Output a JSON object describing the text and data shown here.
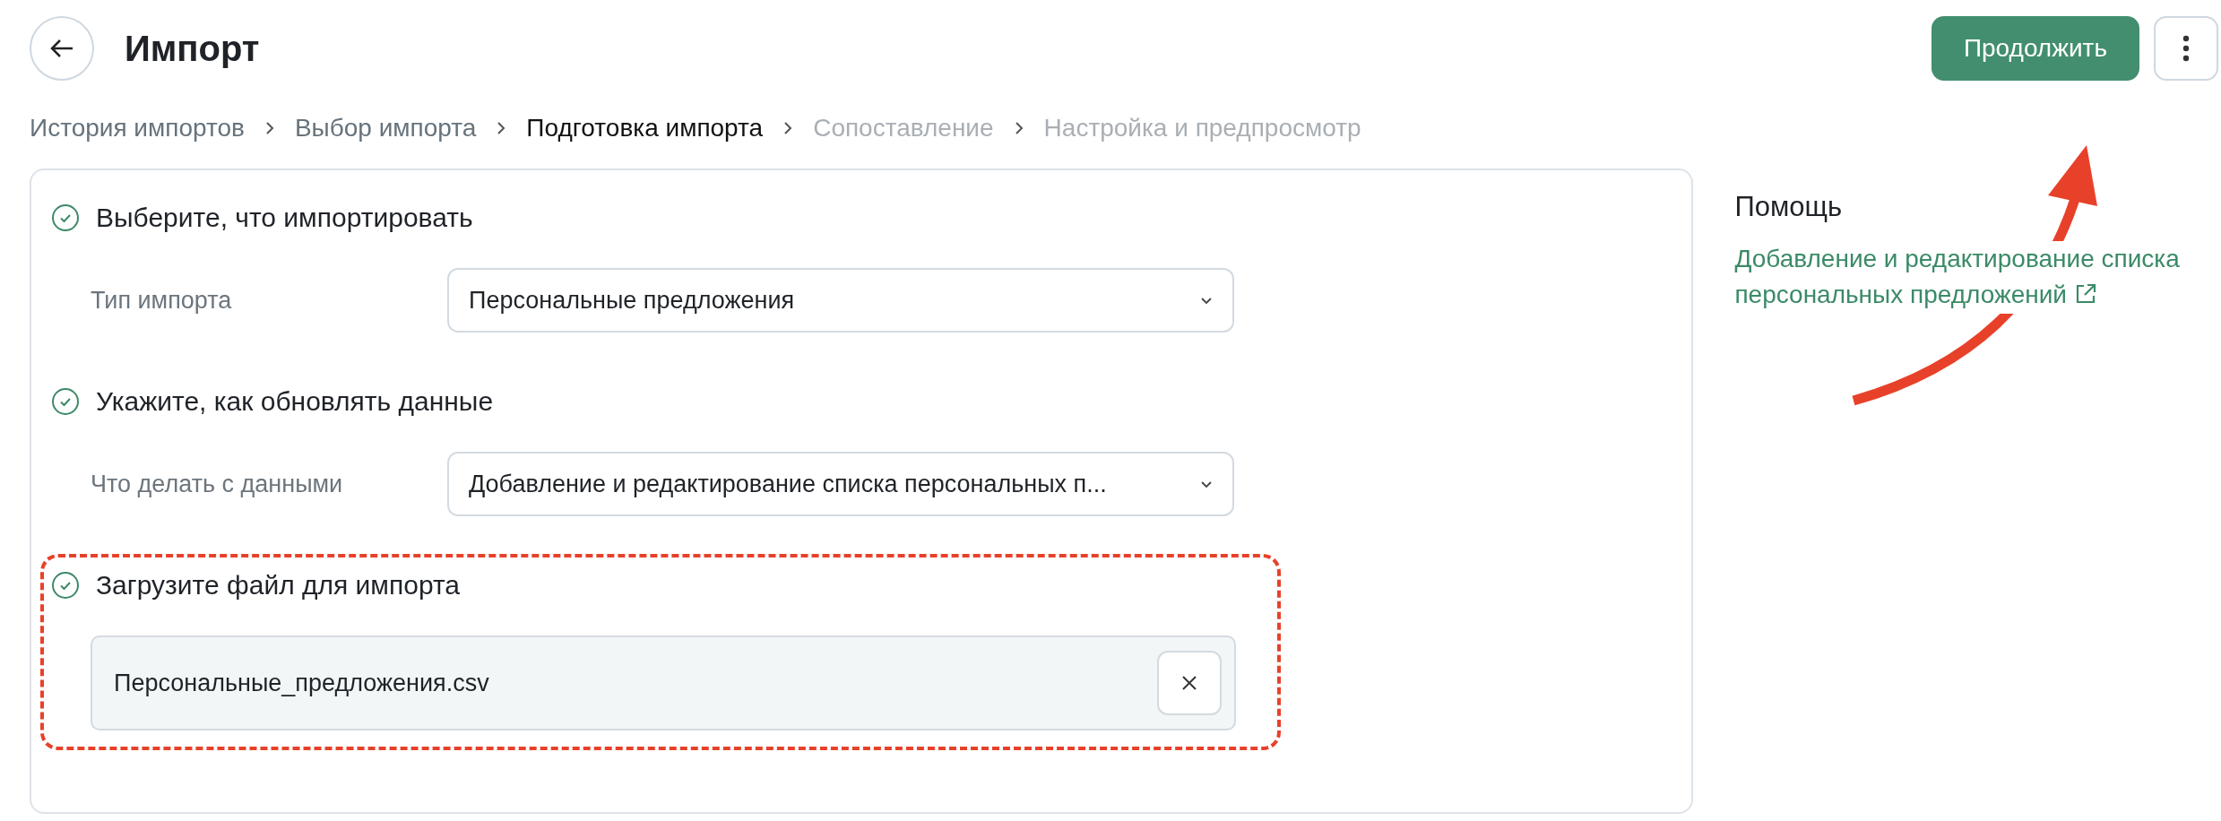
{
  "header": {
    "title": "Импорт",
    "primary_button": "Продолжить"
  },
  "breadcrumbs": [
    {
      "label": "История импортов",
      "selected": false,
      "disabled": false
    },
    {
      "label": "Выбор импорта",
      "selected": false,
      "disabled": false
    },
    {
      "label": "Подготовка импорта",
      "selected": true,
      "disabled": false
    },
    {
      "label": "Сопоставление",
      "selected": false,
      "disabled": true
    },
    {
      "label": "Настройка и предпросмотр",
      "selected": false,
      "disabled": true
    }
  ],
  "steps": [
    {
      "title": "Выберите, что импортировать",
      "done": true,
      "highlighted": false,
      "kind": "select",
      "label": "Тип импорта",
      "value": "Персональные предложения"
    },
    {
      "title": "Укажите, как обновлять данные",
      "done": true,
      "highlighted": false,
      "kind": "select",
      "label": "Что делать с данными",
      "value": "Добавление и редактирование списка персональных п..."
    },
    {
      "title": "Загрузите файл для импорта",
      "done": true,
      "highlighted": true,
      "kind": "file",
      "value": "Персональные_предложения.csv"
    }
  ],
  "help": {
    "title": "Помощь",
    "link": "Добавление и редактирование списка персональных предложений"
  },
  "annotation_arrow": true
}
